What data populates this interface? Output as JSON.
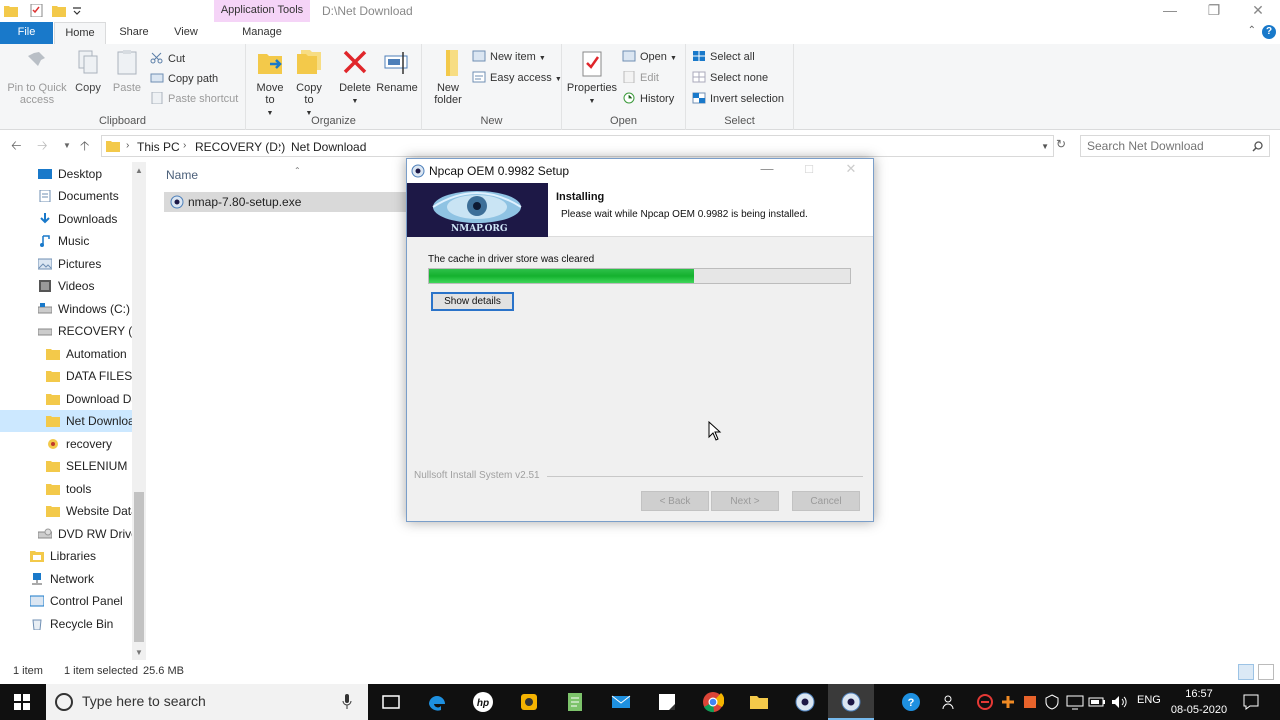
{
  "window": {
    "context_tab": "Application Tools",
    "path_title": "D:\\Net Download"
  },
  "tabs": {
    "file": "File",
    "home": "Home",
    "share": "Share",
    "view": "View",
    "manage": "Manage"
  },
  "ribbon": {
    "clipboard": {
      "label": "Clipboard",
      "pin": "Pin to Quick access",
      "copy": "Copy",
      "paste": "Paste",
      "cut": "Cut",
      "copy_path": "Copy path",
      "paste_shortcut": "Paste shortcut"
    },
    "organize": {
      "label": "Organize",
      "move_to": "Move to",
      "copy_to": "Copy to",
      "delete": "Delete",
      "rename": "Rename"
    },
    "new": {
      "label": "New",
      "new_folder": "New folder",
      "new_item": "New item",
      "easy_access": "Easy access"
    },
    "open": {
      "label": "Open",
      "properties": "Properties",
      "open": "Open",
      "edit": "Edit",
      "history": "History"
    },
    "select": {
      "label": "Select",
      "select_all": "Select all",
      "select_none": "Select none",
      "invert": "Invert selection"
    }
  },
  "address": {
    "crumbs": [
      "This PC",
      "RECOVERY (D:)",
      "Net Download"
    ],
    "search_placeholder": "Search Net Download"
  },
  "nav": {
    "items": [
      "Desktop",
      "Documents",
      "Downloads",
      "Music",
      "Pictures",
      "Videos",
      "Windows (C:)",
      "RECOVERY (D:)",
      "Automation",
      "DATA FILES",
      "Download Da",
      "Net Downloa",
      "recovery",
      "SELENIUM",
      "tools",
      "Website Data",
      "DVD RW Drive",
      "Libraries",
      "Network",
      "Control Panel",
      "Recycle Bin"
    ]
  },
  "filelist": {
    "column_name": "Name",
    "files": [
      "nmap-7.80-setup.exe"
    ]
  },
  "statusbar": {
    "count": "1 item",
    "selected": "1 item selected",
    "size": "25.6 MB"
  },
  "dialog": {
    "title": "Npcap OEM 0.9982 Setup",
    "logo_text": "NMAP.ORG",
    "header_title": "Installing",
    "header_subtitle": "Please wait while Npcap OEM 0.9982 is being installed.",
    "status": "The cache in driver store was cleared",
    "progress": 0.63,
    "show_details": "Show details",
    "brand": "Nullsoft Install System v2.51",
    "back": "< Back",
    "next": "Next >",
    "cancel": "Cancel"
  },
  "taskbar": {
    "search_placeholder": "Type here to search",
    "language": "ENG",
    "time": "16:57",
    "date": "08-05-2020"
  },
  "colors": {
    "accent": "#1979ca",
    "selection": "#cce8ff",
    "context_tab": "#f5d4f7",
    "progress": "#14b12e",
    "taskbar": "#101010"
  }
}
